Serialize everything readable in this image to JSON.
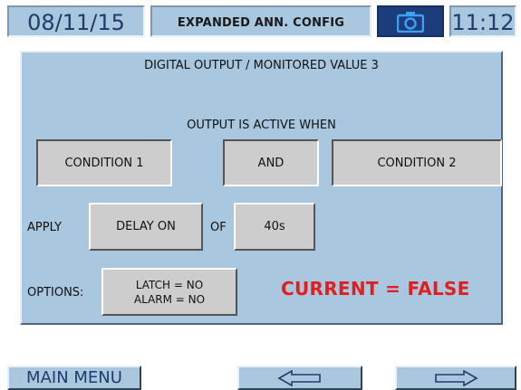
{
  "header": {
    "date": "08/11/15",
    "title": "EXPANDED ANN. CONFIG",
    "camera_icon": "camera-icon",
    "time": "11:12"
  },
  "panel": {
    "title": "DIGITAL OUTPUT / MONITORED VALUE 3",
    "output_active_label": "OUTPUT IS ACTIVE WHEN",
    "condition1": "CONDITION 1",
    "operator": "AND",
    "condition2": "CONDITION 2",
    "apply_label": "APPLY",
    "delay_mode": "DELAY ON",
    "of_label": "OF",
    "delay_value": "40s",
    "options_label": "OPTIONS:",
    "latch": "LATCH = NO",
    "alarm": "ALARM = NO",
    "current_status": "CURRENT = FALSE"
  },
  "nav": {
    "main_menu": "MAIN MENU",
    "back_icon": "arrow-left-icon",
    "forward_icon": "arrow-right-icon"
  },
  "colors": {
    "panel_bg": "#a9c7de",
    "button_bg": "#cdcdcd",
    "status_red": "#e02020",
    "camera_bg": "#1c3c7c",
    "header_text": "#1f3d6b"
  }
}
